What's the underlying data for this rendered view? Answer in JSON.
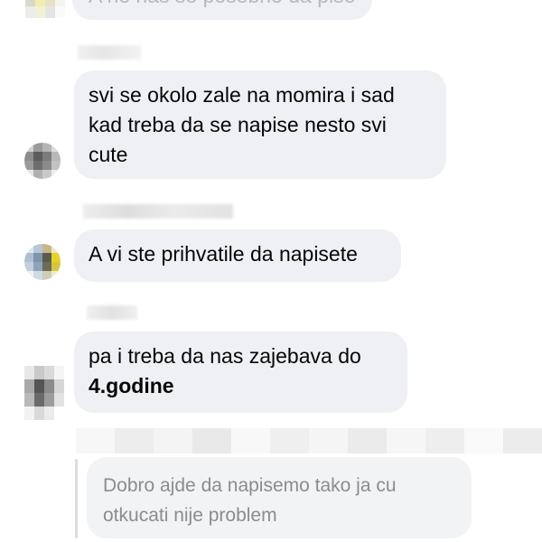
{
  "messages": {
    "top_partial": "A ne nas se posebno da pise",
    "m1": {
      "line1": "svi se okolo zale na momira i sad",
      "line2": "kad treba da se napise nesto svi",
      "line3": "cute"
    },
    "m2": {
      "text": "A vi ste prihvatile da napisete"
    },
    "m3": {
      "line1": "pa i treba da nas zajebava do",
      "line2_bold": "4.godine"
    },
    "reply": {
      "line1": "Dobro ajde da napisemo tako ja cu",
      "line2": "otkucati nije problem"
    }
  },
  "colors": {
    "bubble_bg": "#eef0f3",
    "reply_bg": "#f2f3f5",
    "reply_text": "#8c8c8c",
    "text": "#060606"
  },
  "icons": [
    "avatar-icon"
  ]
}
